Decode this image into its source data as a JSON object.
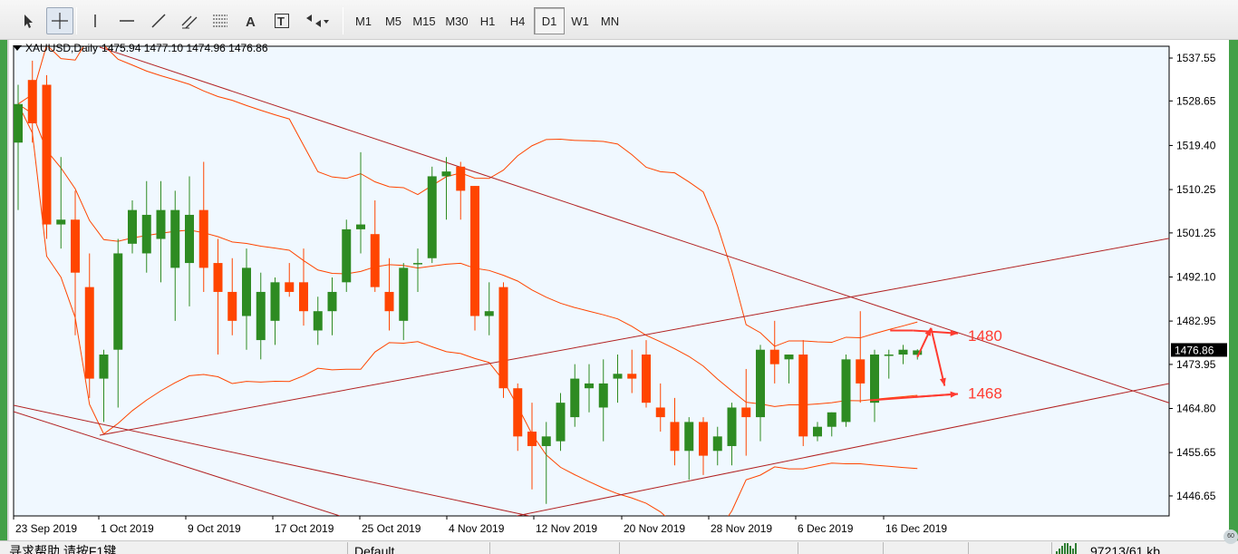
{
  "toolbar": {
    "drawing_tools": [
      {
        "name": "cursor-icon",
        "active": false
      },
      {
        "name": "crosshair-icon",
        "active": true
      },
      {
        "name": "vertical-line-icon",
        "active": false
      },
      {
        "name": "horizontal-line-icon",
        "active": false
      },
      {
        "name": "trendline-icon",
        "active": false
      },
      {
        "name": "equidistant-channel-icon",
        "active": false
      },
      {
        "name": "fibonacci-icon",
        "active": false
      },
      {
        "name": "text-icon",
        "active": false
      },
      {
        "name": "text-label-icon",
        "active": false
      },
      {
        "name": "arrows-icon",
        "active": false
      }
    ],
    "text_tool_label": "A",
    "text_label_tool_label": "T",
    "timeframes": [
      {
        "label": "M1",
        "active": false
      },
      {
        "label": "M5",
        "active": false
      },
      {
        "label": "M15",
        "active": false
      },
      {
        "label": "M30",
        "active": false
      },
      {
        "label": "H1",
        "active": false
      },
      {
        "label": "H4",
        "active": false
      },
      {
        "label": "D1",
        "active": true
      },
      {
        "label": "W1",
        "active": false
      },
      {
        "label": "MN",
        "active": false
      }
    ]
  },
  "chart": {
    "symbol": "XAUUSD,Daily",
    "ohlc": "1475.94 1477.10 1474.96 1476.86",
    "current_price_label": "1476.86",
    "colors": {
      "background": "#f0f8ff",
      "bull": "#2e8b22",
      "bear": "#ff4500",
      "trendline": "#b22222",
      "bollinger": "#ff4500",
      "annotation": "#ff3b30"
    }
  },
  "chart_data": {
    "type": "candlestick",
    "y_axis_ticks": [
      "1537.55",
      "1528.65",
      "1519.40",
      "1510.25",
      "1501.25",
      "1492.10",
      "1482.95",
      "1473.95",
      "1464.80",
      "1455.65",
      "1446.65"
    ],
    "x_axis_ticks": [
      "23 Sep 2019",
      "1 Oct 2019",
      "9 Oct 2019",
      "17 Oct 2019",
      "25 Oct 2019",
      "4 Nov 2019",
      "12 Nov 2019",
      "20 Nov 2019",
      "28 Nov 2019",
      "6 Dec 2019",
      "16 Dec 2019"
    ],
    "ylim": [
      1442.5,
      1540.0
    ],
    "grid": false,
    "candles": [
      [
        1520,
        1532,
        1506,
        1528
      ],
      [
        1533,
        1537,
        1520,
        1524
      ],
      [
        1532,
        1534,
        1500,
        1503
      ],
      [
        1503,
        1517,
        1498,
        1504
      ],
      [
        1504,
        1510,
        1480,
        1493
      ],
      [
        1490,
        1497,
        1467,
        1471
      ],
      [
        1471,
        1477,
        1462,
        1476
      ],
      [
        1477,
        1500,
        1465,
        1497
      ],
      [
        1499,
        1508,
        1497,
        1506
      ],
      [
        1497,
        1512,
        1493,
        1505
      ],
      [
        1500,
        1512,
        1491,
        1506
      ],
      [
        1494,
        1510,
        1483,
        1506
      ],
      [
        1495,
        1513,
        1486,
        1505
      ],
      [
        1506,
        1516,
        1489,
        1494
      ],
      [
        1495,
        1500,
        1476,
        1489
      ],
      [
        1489,
        1496,
        1480,
        1483
      ],
      [
        1484,
        1498,
        1477,
        1494
      ],
      [
        1479,
        1493,
        1475,
        1489
      ],
      [
        1483,
        1492,
        1478,
        1491
      ],
      [
        1491,
        1495,
        1488,
        1489
      ],
      [
        1491,
        1498,
        1482,
        1485
      ],
      [
        1481,
        1488,
        1478,
        1485
      ],
      [
        1485,
        1492,
        1480,
        1489
      ],
      [
        1491,
        1504,
        1489,
        1502
      ],
      [
        1502,
        1518,
        1497,
        1503
      ],
      [
        1501,
        1508,
        1489,
        1490
      ],
      [
        1489,
        1496,
        1481,
        1485
      ],
      [
        1483,
        1495,
        1479,
        1494
      ],
      [
        1495,
        1498,
        1489,
        1495
      ],
      [
        1496,
        1515,
        1495,
        1513
      ],
      [
        1513,
        1517,
        1504,
        1514
      ],
      [
        1515,
        1516,
        1504,
        1510
      ],
      [
        1511,
        1511,
        1481,
        1484
      ],
      [
        1484,
        1491,
        1480,
        1485
      ],
      [
        1490,
        1491,
        1467,
        1469
      ],
      [
        1469,
        1470,
        1456,
        1459
      ],
      [
        1460,
        1466,
        1448,
        1457
      ],
      [
        1457,
        1462,
        1445,
        1459
      ],
      [
        1458,
        1468,
        1456,
        1466
      ],
      [
        1463,
        1474,
        1461,
        1471
      ],
      [
        1469,
        1474,
        1464,
        1470
      ],
      [
        1465,
        1475,
        1458,
        1470
      ],
      [
        1471,
        1476,
        1466,
        1472
      ],
      [
        1472,
        1477,
        1468,
        1471
      ],
      [
        1476,
        1479,
        1465,
        1466
      ],
      [
        1465,
        1470,
        1460,
        1463
      ],
      [
        1462,
        1467,
        1453,
        1456
      ],
      [
        1456,
        1463,
        1450,
        1462
      ],
      [
        1462,
        1463,
        1451,
        1455
      ],
      [
        1456,
        1461,
        1453,
        1459
      ],
      [
        1457,
        1466,
        1453,
        1465
      ],
      [
        1465,
        1473,
        1455,
        1463
      ],
      [
        1463,
        1478,
        1458,
        1477
      ],
      [
        1477,
        1483,
        1470,
        1474
      ],
      [
        1475,
        1476,
        1470,
        1476
      ],
      [
        1476,
        1479,
        1457,
        1459
      ],
      [
        1459,
        1462,
        1458,
        1461
      ],
      [
        1461,
        1464,
        1459,
        1464
      ],
      [
        1462,
        1476,
        1461,
        1475
      ],
      [
        1475,
        1485,
        1466,
        1470
      ],
      [
        1466,
        1477,
        1462,
        1476
      ],
      [
        1476,
        1477,
        1471,
        1476
      ],
      [
        1476,
        1478,
        1474,
        1477
      ],
      [
        1475.94,
        1477.1,
        1474.96,
        1476.86
      ]
    ],
    "annotations": [
      "1480",
      "1468"
    ]
  },
  "status": {
    "help_text": "寻求帮助,请按F1键",
    "profile": "Default",
    "traffic": "97213/61 kb",
    "badge": "60"
  }
}
